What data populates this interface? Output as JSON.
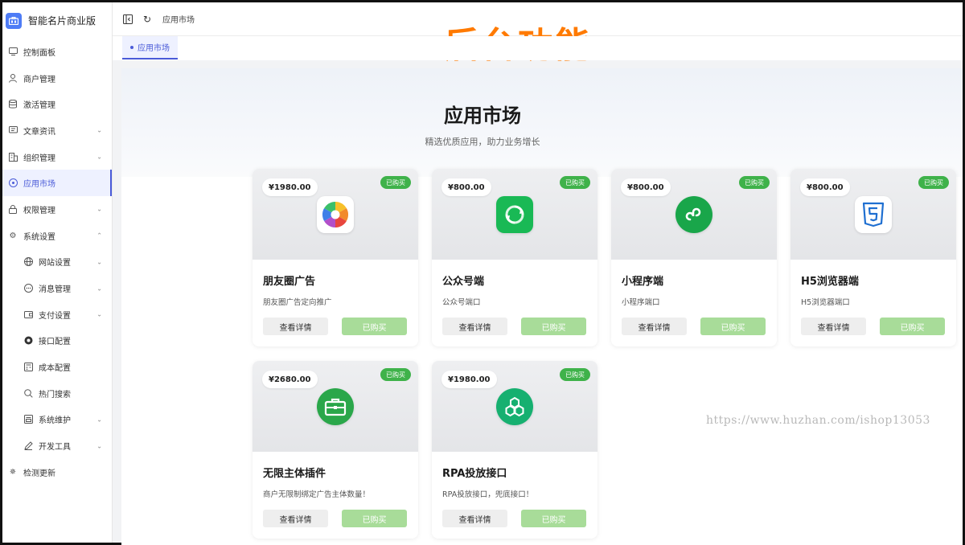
{
  "brand": {
    "title": "智能名片商业版"
  },
  "sidebar": {
    "items": [
      {
        "label": "控制面板",
        "icon": "monitor-icon"
      },
      {
        "label": "商户管理",
        "icon": "user-icon"
      },
      {
        "label": "激活管理",
        "icon": "database-icon"
      },
      {
        "label": "文章资讯",
        "icon": "message-icon",
        "chevron": "down"
      },
      {
        "label": "组织管理",
        "icon": "building-icon",
        "chevron": "down"
      },
      {
        "label": "应用市场",
        "icon": "app-market-icon",
        "active": true
      },
      {
        "label": "权限管理",
        "icon": "lock-icon",
        "chevron": "down"
      },
      {
        "label": "系统设置",
        "icon": "gear-icon",
        "chevron": "up"
      }
    ],
    "sub_items": [
      {
        "label": "网站设置",
        "icon": "globe-icon",
        "chevron": "down"
      },
      {
        "label": "消息管理",
        "icon": "chat-icon",
        "chevron": "down"
      },
      {
        "label": "支付设置",
        "icon": "wallet-icon",
        "chevron": "down"
      },
      {
        "label": "接口配置",
        "icon": "chrome-icon"
      },
      {
        "label": "成本配置",
        "icon": "calculator-icon"
      },
      {
        "label": "热门搜索",
        "icon": "search-icon"
      },
      {
        "label": "系统维护",
        "icon": "maintenance-icon",
        "chevron": "down"
      },
      {
        "label": "开发工具",
        "icon": "pen-icon",
        "chevron": "down"
      }
    ],
    "footer_item": {
      "label": "检测更新",
      "icon": "loading-icon"
    }
  },
  "header": {
    "breadcrumb": "应用市场"
  },
  "banner": "后台功能",
  "tabs": [
    {
      "label": "应用市场"
    }
  ],
  "page": {
    "title": "应用市场",
    "subtitle": "精选优质应用，助力业务增长"
  },
  "buttons": {
    "detail": "查看详情",
    "bought": "已购买",
    "badge": "已购买"
  },
  "apps": [
    {
      "price": "¥1980.00",
      "name": "朋友圈广告",
      "desc": "朋友圈广告定向推广",
      "icon": "aperture-icon",
      "color": "#ffffff"
    },
    {
      "price": "¥800.00",
      "name": "公众号端",
      "desc": "公众号端口",
      "icon": "wechat-official-icon",
      "color": "#19b955"
    },
    {
      "price": "¥800.00",
      "name": "小程序端",
      "desc": "小程序端口",
      "icon": "mini-program-icon",
      "color": "#19a64a"
    },
    {
      "price": "¥800.00",
      "name": "H5浏览器端",
      "desc": "H5浏览器端口",
      "icon": "html5-icon",
      "color": "#1f6fd1"
    },
    {
      "price": "¥2680.00",
      "name": "无限主体插件",
      "desc": "商户无限制绑定广告主体数量！",
      "icon": "briefcase-icon",
      "color": "#2aa74a"
    },
    {
      "price": "¥1980.00",
      "name": "RPA投放接口",
      "desc": "RPA投放接口，兜底接口！",
      "icon": "hexagon-icon",
      "color": "#16b070"
    }
  ],
  "watermark": "https://www.huzhan.com/ishop13053"
}
